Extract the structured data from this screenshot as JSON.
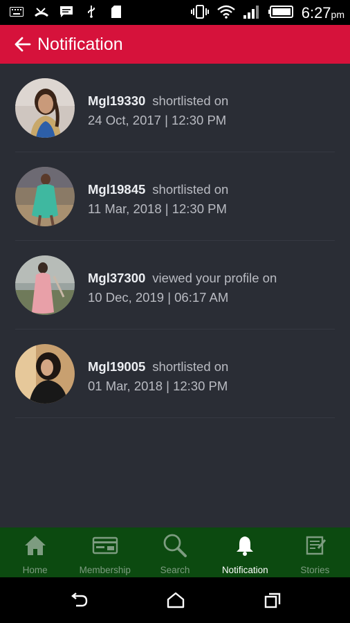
{
  "status_bar": {
    "time": "6:27",
    "ampm": "pm",
    "left_icons": [
      "keyboard-icon",
      "missed-call-icon",
      "message-icon",
      "usb-icon",
      "sd-card-icon"
    ],
    "right_icons": [
      "vibrate-icon",
      "wifi-icon",
      "signal-icon",
      "battery-icon"
    ]
  },
  "header": {
    "title": "Notification",
    "back_icon": "arrow-back-icon",
    "color": "#d6123b"
  },
  "notifications": [
    {
      "user": "Mgl19330",
      "action": "shortlisted on",
      "date": "24 Oct, 2017 | 12:30 PM"
    },
    {
      "user": "Mgl19845",
      "action": "shortlisted on",
      "date": "11 Mar, 2018 | 12:30 PM"
    },
    {
      "user": "Mgl37300",
      "action": "viewed your profile on",
      "date": "10 Dec, 2019 | 06:17 AM"
    },
    {
      "user": "Mgl19005",
      "action": "shortlisted on",
      "date": "01 Mar, 2018 | 12:30 PM"
    }
  ],
  "bottom_nav": {
    "background": "#0c4a10",
    "items": [
      {
        "label": "Home",
        "icon": "home-icon",
        "active": false
      },
      {
        "label": "Membership",
        "icon": "membership-card-icon",
        "active": false
      },
      {
        "label": "Search",
        "icon": "search-icon",
        "active": false
      },
      {
        "label": "Notification",
        "icon": "bell-icon",
        "active": true
      },
      {
        "label": "Stories",
        "icon": "stories-icon",
        "active": false
      }
    ]
  },
  "system_nav": {
    "icons": [
      "back-icon",
      "home-circle-icon",
      "recents-icon"
    ]
  }
}
